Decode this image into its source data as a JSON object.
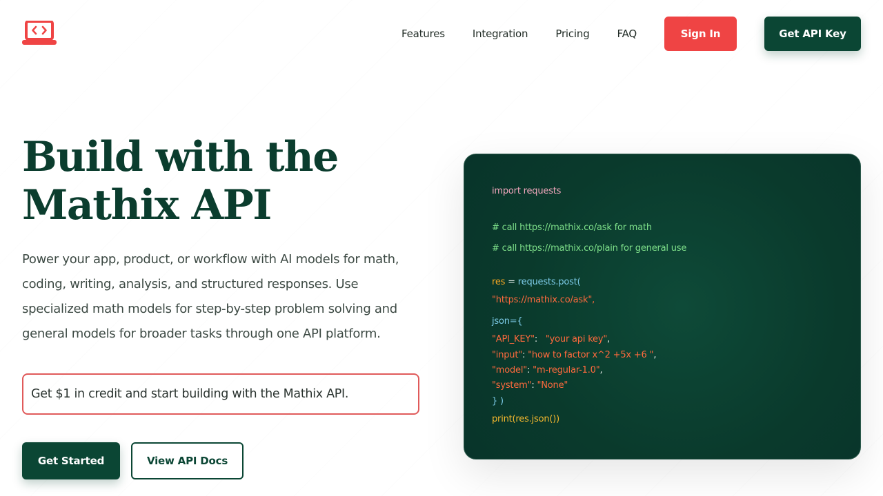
{
  "colors": {
    "brand_green": "#0b4634",
    "accent_red": "#ef4444",
    "code_bg": "#0a3a2c"
  },
  "header": {
    "logo_icon": "code-laptop-icon",
    "nav": {
      "features": "Features",
      "integration": "Integration",
      "pricing": "Pricing",
      "faq": "FAQ"
    },
    "sign_in": "Sign In",
    "get_api_key": "Get API Key"
  },
  "hero": {
    "title_line1": "Build with the",
    "title_line2": "Mathix API",
    "description": "Power your app, product, or workflow with AI models for math, coding, writing, analysis, and structured responses. Use specialized math models for step-by-step problem solving and general models for broader tasks through one API platform.",
    "credit_note": "Get $1 in credit and start building with the Mathix API.",
    "get_started": "Get Started",
    "view_docs": "View API Docs"
  },
  "code": {
    "import": "import requests",
    "comment1": "# call https://mathix.co/ask for math",
    "comment2": "# call https://mathix.co/plain for general use",
    "res_var": "res",
    "assign": " = ",
    "post_call": "requests.post(",
    "url": "\"https://mathix.co/ask\",",
    "json_open": "json={",
    "key_api": "\"API_KEY\"",
    "colon1": ":   ",
    "val_api": "\"your api key\"",
    "comma1": ",",
    "key_input": "\"input\"",
    "colon2": ": ",
    "val_input": "\"how to factor x^2 +5x +6 \"",
    "comma2": ",",
    "key_model": "\"model\"",
    "colon3": ": ",
    "val_model": "\"m-regular-1.0\"",
    "comma3": ",",
    "key_system": "\"system\"",
    "colon4": ": ",
    "val_system": "\"None\"",
    "close": "} )",
    "print": "print(res.json())"
  }
}
